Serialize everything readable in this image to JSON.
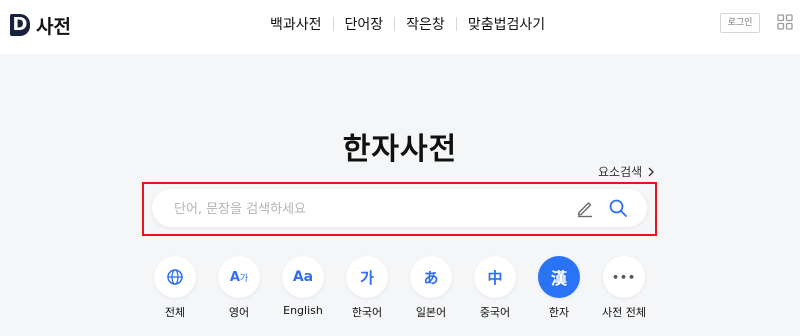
{
  "brand": {
    "logo_letter": "D",
    "name": "사전"
  },
  "nav": [
    {
      "label": "백과사전"
    },
    {
      "label": "단어장"
    },
    {
      "label": "작은창"
    },
    {
      "label": "맞춤법검사기"
    }
  ],
  "header": {
    "login_label": "로그인"
  },
  "main": {
    "title": "한자사전",
    "element_search_label": "요소검색",
    "search": {
      "placeholder": "단어, 문장을 검색하세요",
      "value": ""
    }
  },
  "categories": [
    {
      "label": "전체",
      "glyph": "",
      "icon": "globe-icon",
      "active": false
    },
    {
      "label": "영어",
      "glyph": "A",
      "glyph_small": "가",
      "icon": "english-korean-icon",
      "active": false
    },
    {
      "label": "English",
      "glyph": "Aa",
      "icon": "english-icon",
      "active": false
    },
    {
      "label": "한국어",
      "glyph": "가",
      "icon": "korean-icon",
      "active": false
    },
    {
      "label": "일본어",
      "glyph": "あ",
      "icon": "japanese-icon",
      "active": false
    },
    {
      "label": "중국어",
      "glyph": "中",
      "icon": "chinese-icon",
      "active": false
    },
    {
      "label": "한자",
      "glyph": "漢",
      "icon": "hanja-icon",
      "active": true
    },
    {
      "label": "사전 전체",
      "glyph": "•••",
      "icon": "more-icon",
      "active": false
    }
  ],
  "colors": {
    "accent": "#2a73f6",
    "highlight_border": "#e8141b",
    "logo": "#16213e"
  }
}
